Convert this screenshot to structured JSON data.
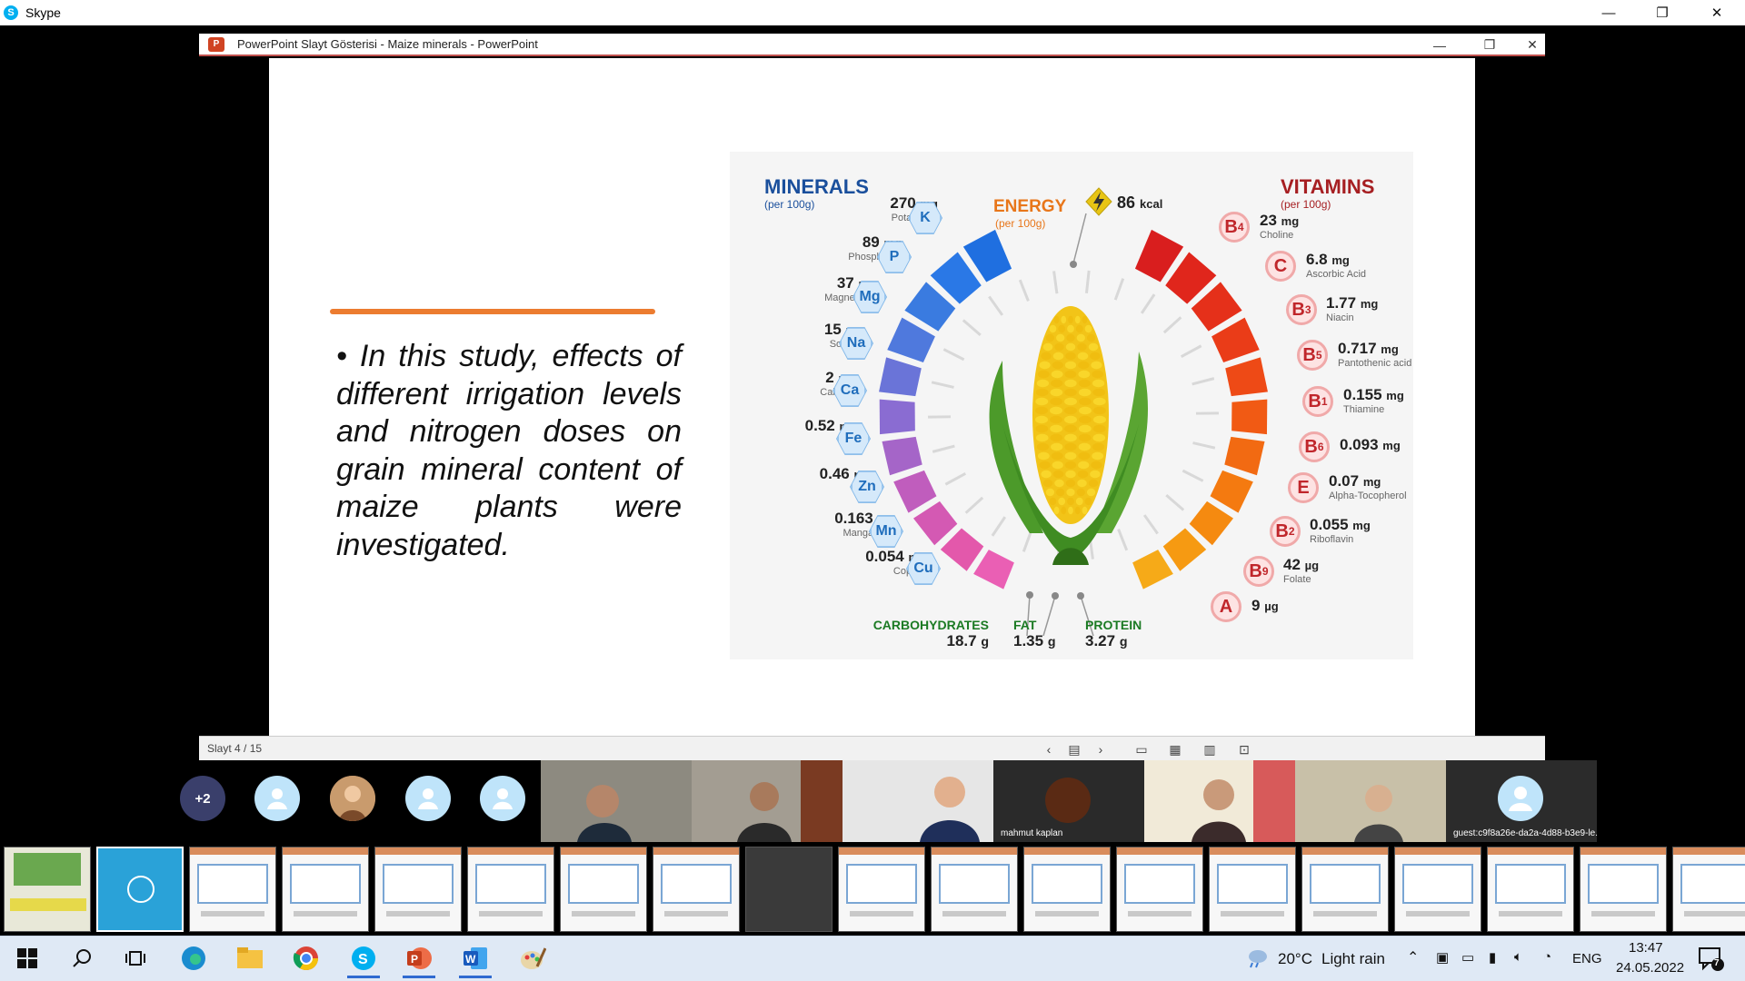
{
  "skype": {
    "title": "Skype",
    "logo": "S",
    "minimize": "—",
    "restore": "❐",
    "close": "✕"
  },
  "ppt": {
    "caption": "PowerPoint Slayt Gösterisi  -  Maize minerals - PowerPoint",
    "icon_letter": "P",
    "minimize": "—",
    "restore": "❐",
    "close": "✕",
    "status": "Slayt 4 / 15",
    "status_icons": [
      "chevron-left-icon",
      "slide-list-icon",
      "chevron-right-icon",
      "normal-view-icon",
      "grid-view-icon",
      "reading-view-icon",
      "slideshow-icon"
    ]
  },
  "slide": {
    "body": "• In this study, effects of different irrigation levels and nitrogen doses on grain mineral content of maize plants were investigated."
  },
  "infographic": {
    "minerals_title": "MINERALS",
    "minerals_sub": "(per 100g)",
    "energy_title": "ENERGY",
    "energy_sub": "(per 100g)",
    "energy_value": "86",
    "energy_unit": "kcal",
    "vitamins_title": "VITAMINS",
    "vitamins_sub": "(per 100g)",
    "minerals": [
      {
        "value": "270",
        "unit": "mg",
        "name": "Potassium",
        "symbol": "K"
      },
      {
        "value": "89",
        "unit": "mg",
        "name": "Phosphorus",
        "symbol": "P"
      },
      {
        "value": "37",
        "unit": "mg",
        "name": "Magnesium",
        "symbol": "Mg"
      },
      {
        "value": "15",
        "unit": "mg",
        "name": "Sodium",
        "symbol": "Na"
      },
      {
        "value": "2",
        "unit": "mg",
        "name": "Calcium",
        "symbol": "Ca"
      },
      {
        "value": "0.52",
        "unit": "mg",
        "name": "Iron",
        "symbol": "Fe"
      },
      {
        "value": "0.46",
        "unit": "mg",
        "name": "Zinc",
        "symbol": "Zn"
      },
      {
        "value": "0.163",
        "unit": "mg",
        "name": "Manganese",
        "symbol": "Mn"
      },
      {
        "value": "0.054",
        "unit": "mg",
        "name": "Copper",
        "symbol": "Cu"
      }
    ],
    "vitamins": [
      {
        "value": "23",
        "unit": "mg",
        "name": "Choline",
        "symbol": "B",
        "sub": "4"
      },
      {
        "value": "6.8",
        "unit": "mg",
        "name": "Ascorbic Acid",
        "symbol": "C",
        "sub": ""
      },
      {
        "value": "1.77",
        "unit": "mg",
        "name": "Niacin",
        "symbol": "B",
        "sub": "3"
      },
      {
        "value": "0.717",
        "unit": "mg",
        "name": "Pantothenic acid",
        "symbol": "B",
        "sub": "5"
      },
      {
        "value": "0.155",
        "unit": "mg",
        "name": "Thiamine",
        "symbol": "B",
        "sub": "1"
      },
      {
        "value": "0.093",
        "unit": "mg",
        "name": "",
        "symbol": "B",
        "sub": "6"
      },
      {
        "value": "0.07",
        "unit": "mg",
        "name": "Alpha-Tocopherol",
        "symbol": "E",
        "sub": ""
      },
      {
        "value": "0.055",
        "unit": "mg",
        "name": "Riboflavin",
        "symbol": "B",
        "sub": "2"
      },
      {
        "value": "42",
        "unit": "µg",
        "name": "Folate",
        "symbol": "B",
        "sub": "9"
      },
      {
        "value": "9",
        "unit": "µg",
        "name": "",
        "symbol": "A",
        "sub": ""
      }
    ],
    "macros": [
      {
        "label": "CARBOHYDRATES",
        "value": "18.7",
        "unit": "g"
      },
      {
        "label": "FAT",
        "value": "1.35",
        "unit": "g"
      },
      {
        "label": "PROTEIN",
        "value": "3.27",
        "unit": "g"
      }
    ]
  },
  "participants": {
    "overflow": "+2",
    "named": [
      {
        "name": "mahmut kaplan"
      },
      {
        "name": "guest:c9f8a26e-da2a-4d88-b3e9-le..."
      }
    ]
  },
  "thumbnails": {
    "count": 19,
    "active_index": 1
  },
  "taskbar": {
    "weather_temp": "20°C",
    "weather_desc": "Light rain",
    "language": "ENG",
    "time": "13:47",
    "date": "24.05.2022",
    "notifications": "7",
    "apps": [
      "windows-start-icon",
      "search-icon",
      "task-view-icon",
      "edge-icon",
      "file-explorer-icon",
      "chrome-icon",
      "skype-icon",
      "powerpoint-icon",
      "word-icon",
      "paint-icon"
    ]
  },
  "colors": {
    "accent_orange": "#ec7c30",
    "minerals_blue": "#1a4f9c",
    "vitamins_red": "#a61f22",
    "energy_orange": "#e8761a",
    "macros_green": "#1b7a23"
  }
}
